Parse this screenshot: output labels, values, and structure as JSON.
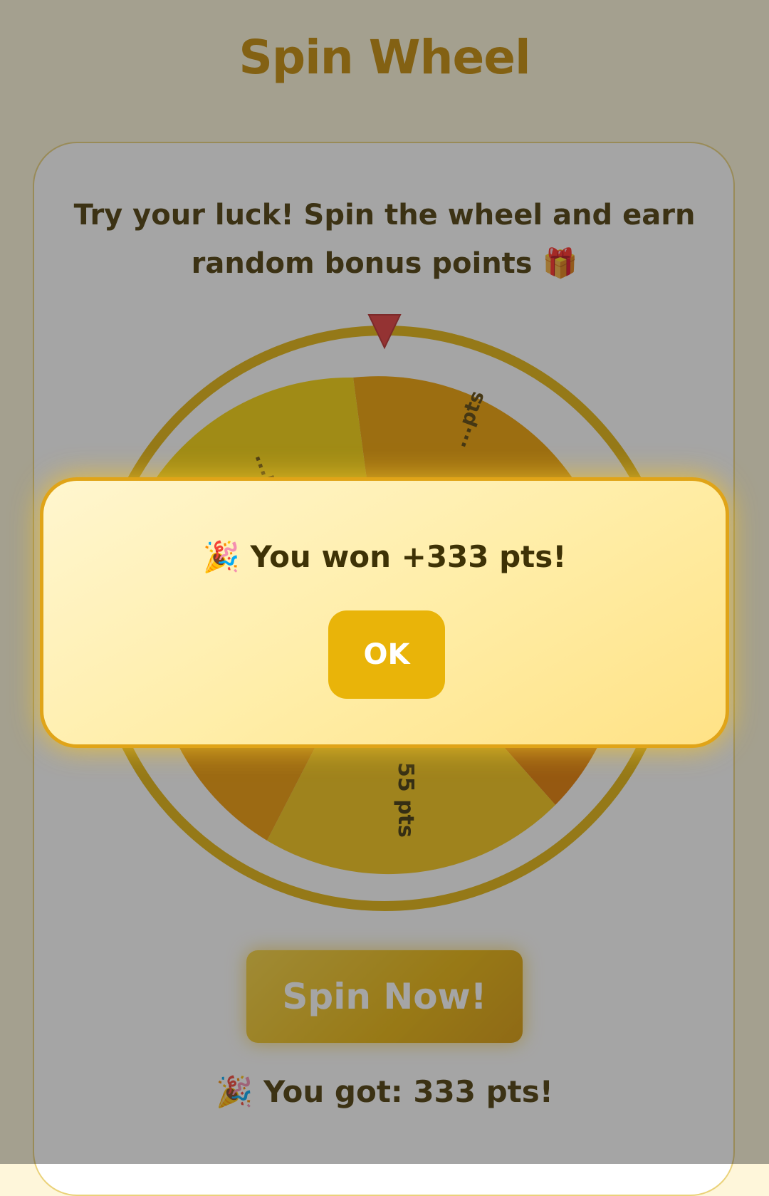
{
  "header": {
    "title": "Spin Wheel"
  },
  "card": {
    "subtitle": "Try your luck! Spin the wheel and earn random bonus points 🎁"
  },
  "wheel": {
    "visible_segment_labels": [
      "...pts",
      "...pts",
      "55 pts"
    ],
    "pointer_icon": "triangle-pointer-icon",
    "colors": {
      "rim": "#E3B40D",
      "pointer": "#E23B3B",
      "segment_a": "#F7D20A",
      "segment_b": "#F0A100",
      "segment_c": "#F4B90A",
      "segment_d": "#E67C00"
    }
  },
  "actions": {
    "spin_label": "Spin Now!"
  },
  "result": {
    "text": "🎉 You got: 333 pts!"
  },
  "modal": {
    "message": "🎉 You won +333 pts!",
    "ok_label": "OK"
  },
  "theme": {
    "title_color": "#C48A04",
    "text_color": "#4A3A06",
    "accent": "#E9B409"
  }
}
